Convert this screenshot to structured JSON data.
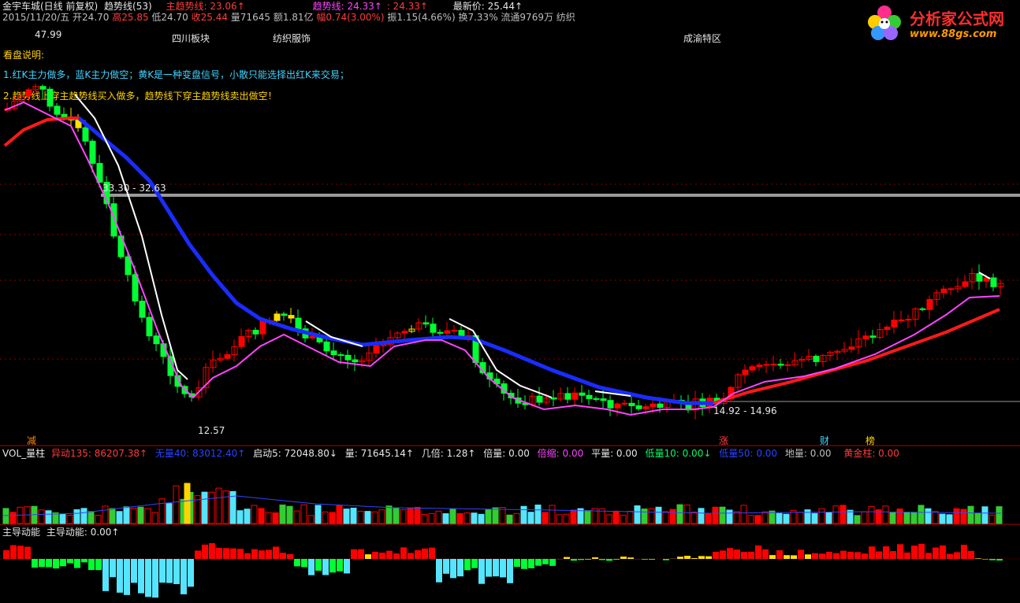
{
  "header": {
    "line1": [
      {
        "text": "金宇车城(日线 前复权)",
        "color": "white"
      },
      {
        "text": "趋势线(53)",
        "color": "white"
      },
      {
        "text": "主趋势线: 23.06↑",
        "color": "red"
      },
      {
        "text": "趋势线: 24.33↑",
        "color": "magenta"
      },
      {
        "text": ": 24.33↑",
        "color": "red"
      },
      {
        "text": "最新价: 25.44↑",
        "color": "white"
      }
    ],
    "line2": [
      {
        "text": "2015/11/20/五",
        "color": "gray"
      },
      {
        "text": "开24.70",
        "color": "gray"
      },
      {
        "text": "高25.85",
        "color": "red"
      },
      {
        "text": "低24.70",
        "color": "gray"
      },
      {
        "text": "收25.44",
        "color": "red"
      },
      {
        "text": "量71645",
        "color": "gray"
      },
      {
        "text": "额1.81亿",
        "color": "gray"
      },
      {
        "text": "幅0.74(3.00%)",
        "color": "red"
      },
      {
        "text": "振1.15(4.66%)",
        "color": "gray"
      },
      {
        "text": "换7.33%",
        "color": "gray"
      },
      {
        "text": "流通9769万",
        "color": "gray"
      },
      {
        "text": "纺织",
        "color": "gray"
      }
    ]
  },
  "logo": {
    "title": "分析家公式网",
    "url": "www.88gs.com"
  },
  "sectors": [
    "四川板块",
    "纺织服饰",
    "成渝特区"
  ],
  "notes": {
    "title": "看盘说明:",
    "line1": "1.红K主力做多，蓝K主力做空；黄K是一种变盘信号，小散只能选择出红K来交易；",
    "line2": "2.趋势线上穿主趋势线买入做多，趋势线下穿主趋势线卖出做空！"
  },
  "price_labels": {
    "high": "47.99",
    "range1": "33.30 - 32.63",
    "low": "12.57",
    "range2": "14.92 - 14.96"
  },
  "signals": {
    "jian": "减",
    "zhang": "涨",
    "cai": "财",
    "bang": "榜"
  },
  "vol_header": [
    {
      "text": "VOL_量柱",
      "color": "white"
    },
    {
      "text": "异动135: 86207.38↑",
      "color": "red"
    },
    {
      "text": "无量40: 83012.40↑",
      "color": "blue"
    },
    {
      "text": "启动5: 72048.80↓",
      "color": "white"
    },
    {
      "text": "量: 71645.14↑",
      "color": "white"
    },
    {
      "text": "几倍: 1.28↑",
      "color": "white"
    },
    {
      "text": "倍量: 0.00",
      "color": "white"
    },
    {
      "text": "倍缩: 0.00",
      "color": "magenta"
    },
    {
      "text": "平量: 0.00",
      "color": "white"
    },
    {
      "text": "低量10: 0.00↓",
      "color": "green"
    },
    {
      "text": "低量50: 0.00",
      "color": "blue"
    },
    {
      "text": "地量: 0.00",
      "color": "gray"
    },
    {
      "text": "黄金柱: 0.00",
      "color": "red"
    }
  ],
  "momentum_header": [
    {
      "text": "主导动能",
      "color": "white"
    },
    {
      "text": "主导动能: 0.00↑",
      "color": "white"
    }
  ],
  "colors": {
    "up": "#ff0000",
    "down": "#00ff33",
    "yellow": "#ffe000",
    "blue_line": "#1a2cff",
    "red_line": "#ff1a1a",
    "magenta_line": "#ff44ff",
    "white_line": "#ffffff",
    "cyan": "#55e5ff",
    "gridline": "#8a0000"
  }
}
